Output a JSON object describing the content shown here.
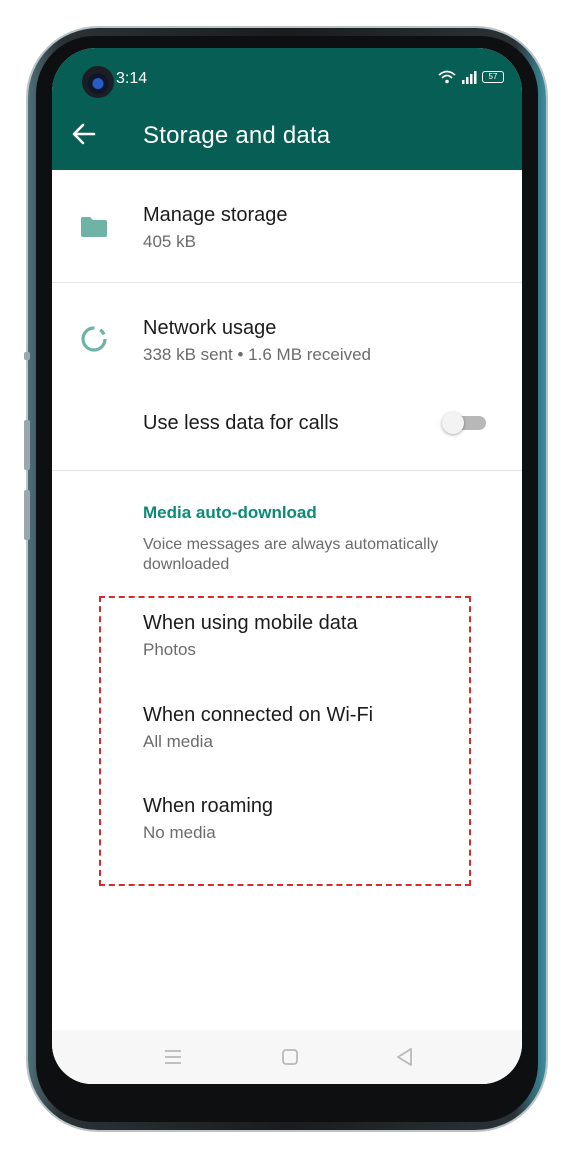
{
  "status_bar": {
    "time": "3:14",
    "battery": "57",
    "icons": [
      "wifi-icon",
      "signal-icon",
      "battery-icon"
    ]
  },
  "app_bar": {
    "title": "Storage and data",
    "back_icon": "arrow-left-icon",
    "color": "#075e54"
  },
  "storage": {
    "label": "Manage storage",
    "value": "405 kB",
    "icon": "folder-icon"
  },
  "network": {
    "label": "Network usage",
    "value": "338 kB sent • 1.6 MB received",
    "icon": "data-usage-icon"
  },
  "calls": {
    "label": "Use less data for calls",
    "toggle_on": false
  },
  "media": {
    "header": "Media auto-download",
    "note": "Voice messages are always automatically downloaded",
    "accent": "#0c8a78",
    "items": [
      {
        "label": "When using mobile data",
        "value": "Photos"
      },
      {
        "label": "When connected on Wi-Fi",
        "value": "All media"
      },
      {
        "label": "When roaming",
        "value": "No media"
      }
    ]
  },
  "annotation_color": "#d62b2b",
  "nav_bar": {
    "icons": [
      "menu-icon",
      "home-icon",
      "back-triangle-icon"
    ]
  }
}
